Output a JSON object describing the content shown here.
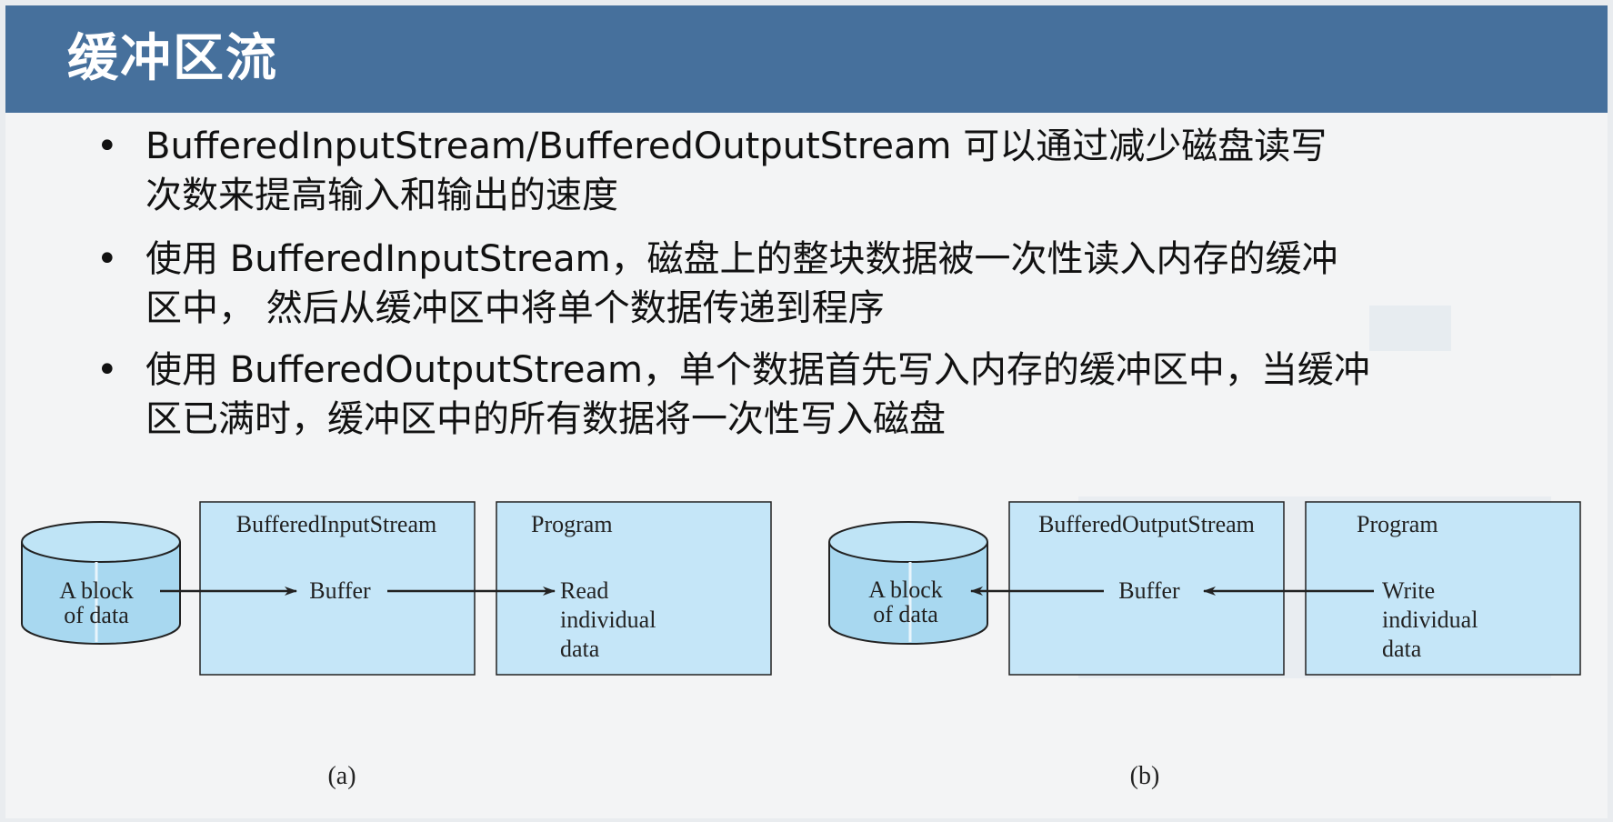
{
  "slide": {
    "title": "缓冲区流",
    "bullets": [
      "BufferedInputStream/BufferedOutputStream 可以通过减少磁盘读写次数来提高输入和输出的速度",
      "使用 BufferedInputStream，磁盘上的整块数据被一次性读入内存的缓冲区中， 然后从缓冲区中将单个数据传递到程序",
      "使用 BufferedOutputStream，单个数据首先写入内存的缓冲区中，当缓冲区已满时，缓冲区中的所有数据将一次性写入磁盘"
    ]
  },
  "diagrams": {
    "a": {
      "disk_line1": "A block",
      "disk_line2": "of data",
      "stream_label": "BufferedInputStream",
      "buffer_label": "Buffer",
      "program_label": "Program",
      "program_line1": "Read",
      "program_line2": "individual",
      "program_line3": "data",
      "caption": "(a)"
    },
    "b": {
      "disk_line1": "A block",
      "disk_line2": "of data",
      "stream_label": "BufferedOutputStream",
      "buffer_label": "Buffer",
      "program_label": "Program",
      "program_line1": "Write",
      "program_line2": "individual",
      "program_line3": "data",
      "caption": "(b)"
    },
    "colors": {
      "box_fill": "#c5e6f8",
      "disk_fill": "#a8d8f0",
      "stroke": "#222222"
    }
  }
}
